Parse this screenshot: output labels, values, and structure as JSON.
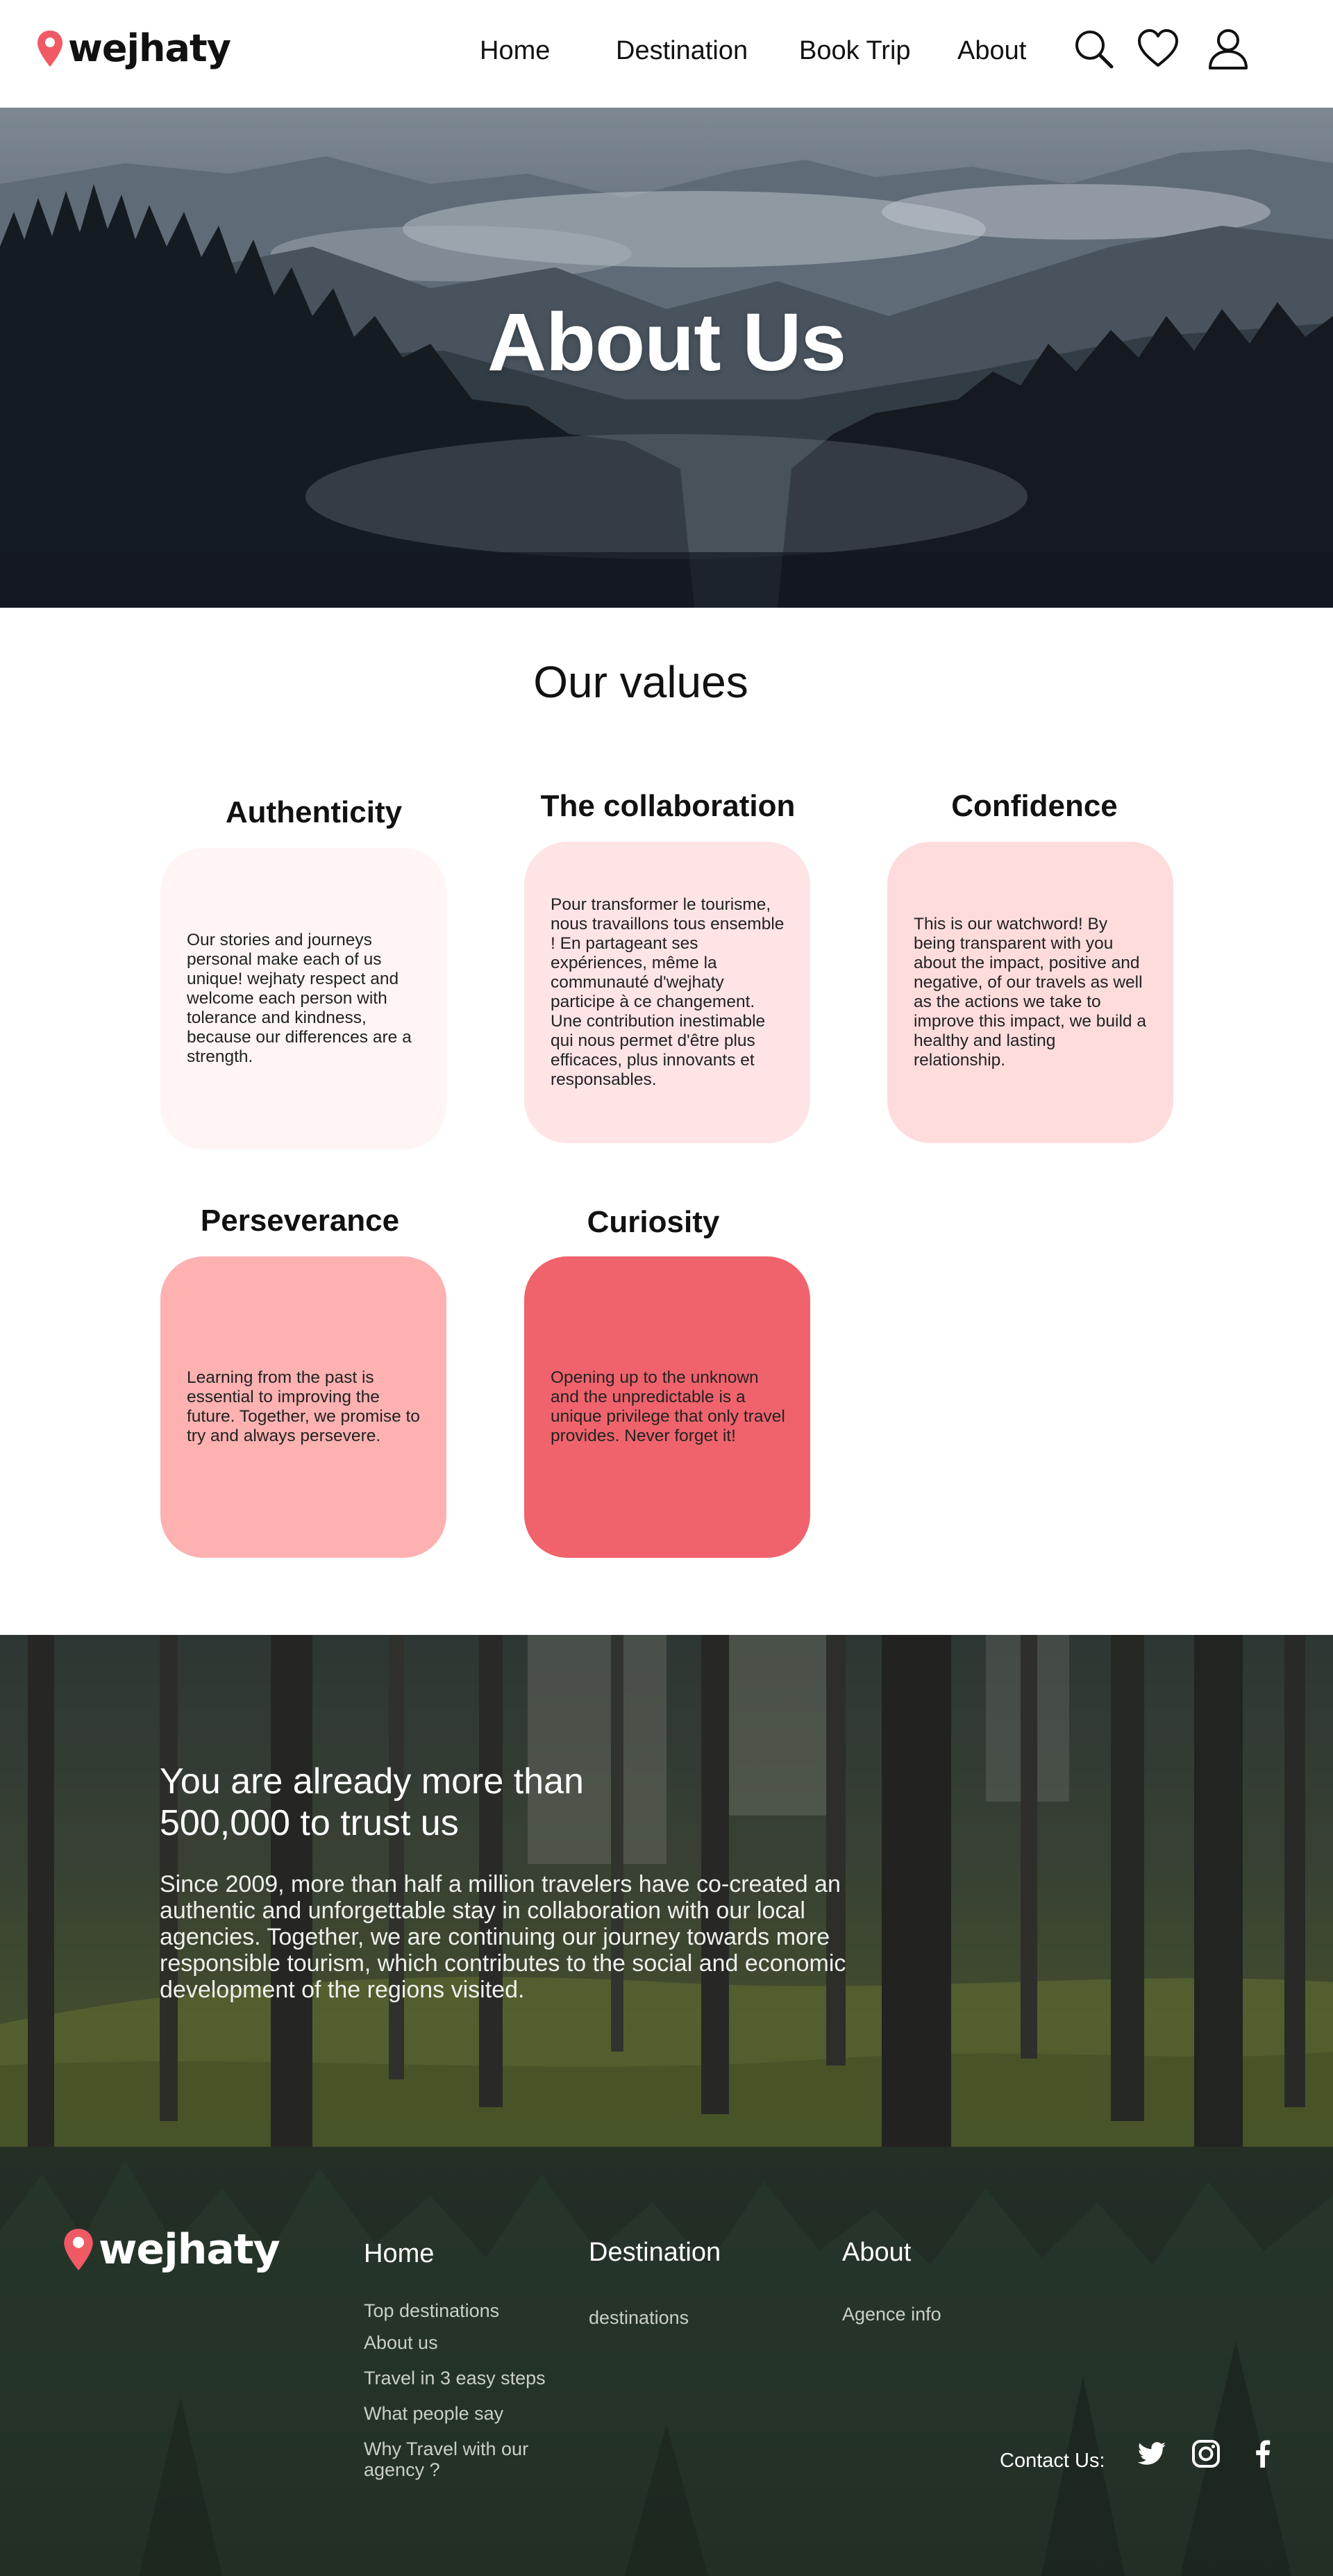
{
  "brand": {
    "name": "wejhaty",
    "accent": "#ef5a64"
  },
  "nav": {
    "items": [
      "Home",
      "Destination",
      "Book Trip",
      "About"
    ],
    "icons": [
      "search-icon",
      "heart-icon",
      "user-icon"
    ]
  },
  "hero": {
    "title": "About Us"
  },
  "values": {
    "heading": "Our values",
    "cards": [
      {
        "title": "Authenticity",
        "color": "#fff5f4",
        "text": "Our stories and journeys personal make each of us unique! wejhaty respect and welcome each person with tolerance and kindness, because our differences are a strength."
      },
      {
        "title": "The collaboration",
        "color": "#ffe4e6",
        "text": "Pour transformer le tourisme, nous travaillons tous ensemble ! En partageant ses expériences, même la communauté d'wejhaty participe à ce changement. Une contribution inestimable qui nous permet d'être plus efficaces, plus innovants et responsables."
      },
      {
        "title": "Confidence",
        "color": "#ffdcdc",
        "text": "This is our watchword! By being transparent with you about the impact, positive and negative, of our travels as well as the actions we take to improve this impact, we build a healthy and lasting relationship."
      },
      {
        "title": "Perseverance",
        "color": "#fdb1b1",
        "text": "Learning from the past is essential to improving the future. Together, we promise to try and always persevere."
      },
      {
        "title": "Curiosity",
        "color": "#f0636c",
        "text": "Opening up to the unknown and the unpredictable is a unique privilege that only travel provides. Never forget it!"
      }
    ]
  },
  "trust": {
    "heading": "You are already more than 500,000 to trust us",
    "body": "Since 2009, more than half a million travelers have co-created an authentic and unforgettable stay in collaboration with our local agencies. Together, we are continuing our journey towards more responsible tourism, which contributes to the social and economic development of the regions visited."
  },
  "footer": {
    "columns": [
      {
        "title": "Home",
        "links": [
          "Top destinations",
          "About us",
          "Travel in 3 easy steps",
          "What people say",
          "Why Travel with our agency ?"
        ]
      },
      {
        "title": "Destination",
        "links": [
          "destinations"
        ]
      },
      {
        "title": "About",
        "links": [
          "Agence info"
        ]
      }
    ],
    "contact_label": "Contact Us:",
    "social_icons": [
      "twitter-icon",
      "instagram-icon",
      "facebook-icon"
    ]
  }
}
